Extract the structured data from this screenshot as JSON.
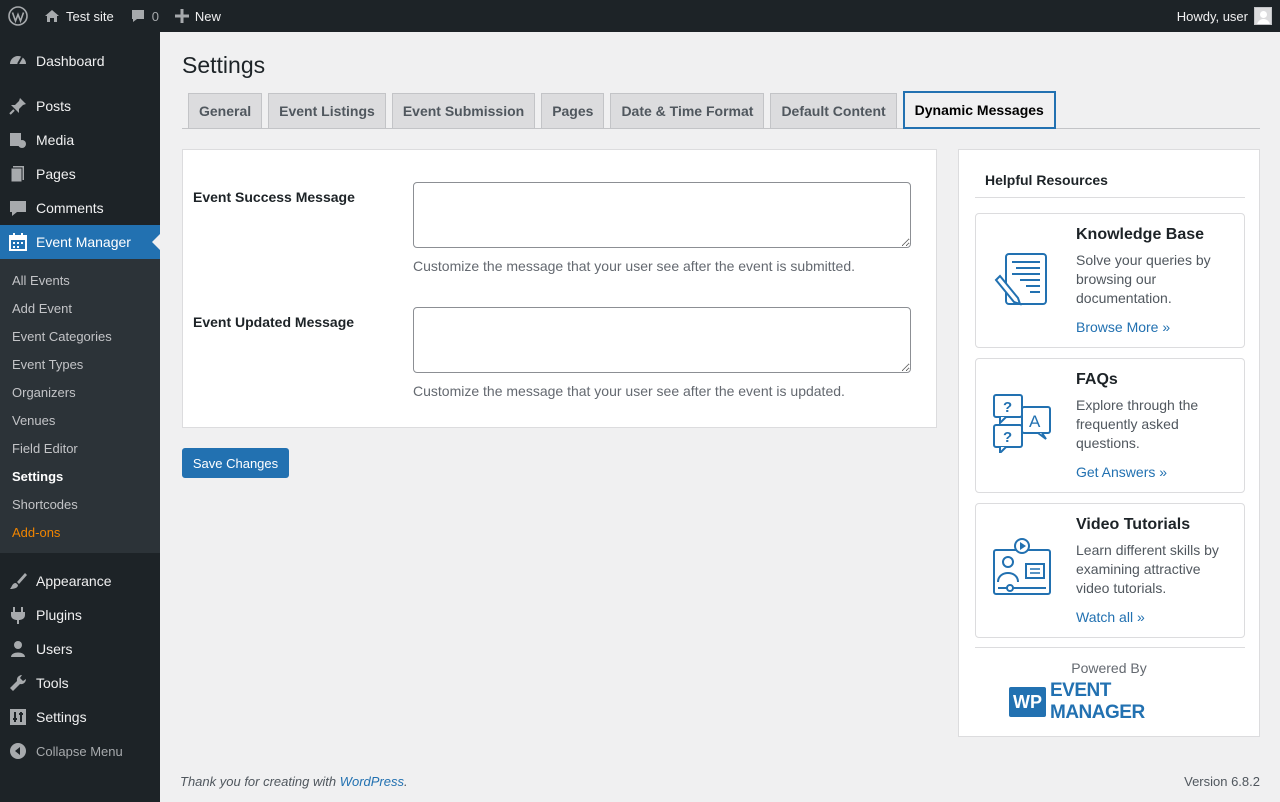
{
  "admin_bar": {
    "site_name": "Test site",
    "comments_count": "0",
    "new_label": "New",
    "howdy": "Howdy, user"
  },
  "sidebar": {
    "items_top": [
      {
        "label": "Dashboard",
        "icon": "dashboard-icon"
      },
      {
        "label": "Posts",
        "icon": "pin-icon"
      },
      {
        "label": "Media",
        "icon": "media-icon"
      },
      {
        "label": "Pages",
        "icon": "pages-icon"
      },
      {
        "label": "Comments",
        "icon": "comment-icon"
      },
      {
        "label": "Event Manager",
        "icon": "calendar-icon"
      }
    ],
    "submenu": [
      "All Events",
      "Add Event",
      "Event Categories",
      "Event Types",
      "Organizers",
      "Venues",
      "Field Editor",
      "Settings",
      "Shortcodes",
      "Add-ons"
    ],
    "items_bottom": [
      {
        "label": "Appearance",
        "icon": "brush-icon"
      },
      {
        "label": "Plugins",
        "icon": "plug-icon"
      },
      {
        "label": "Users",
        "icon": "user-icon"
      },
      {
        "label": "Tools",
        "icon": "wrench-icon"
      },
      {
        "label": "Settings",
        "icon": "settings-icon"
      }
    ],
    "collapse_label": "Collapse Menu"
  },
  "page": {
    "title": "Settings",
    "tabs": [
      "General",
      "Event Listings",
      "Event Submission",
      "Pages",
      "Date & Time Format",
      "Default Content",
      "Dynamic Messages"
    ],
    "active_tab": "Dynamic Messages"
  },
  "form": {
    "success_label": "Event Success Message",
    "success_value": "",
    "success_desc": "Customize the message that your user see after the event is submitted.",
    "updated_label": "Event Updated Message",
    "updated_value": "",
    "updated_desc": "Customize the message that your user see after the event is updated.",
    "save_label": "Save Changes"
  },
  "resources": {
    "title": "Helpful Resources",
    "cards": [
      {
        "title": "Knowledge Base",
        "desc": "Solve your queries by browsing our documentation.",
        "link": "Browse More »",
        "icon": "document-icon"
      },
      {
        "title": "FAQs",
        "desc": "Explore through the frequently asked questions.",
        "link": "Get Answers »",
        "icon": "faq-icon"
      },
      {
        "title": "Video Tutorials",
        "desc": "Learn different skills by examining attractive video tutorials.",
        "link": "Watch all »",
        "icon": "video-tutorial-icon"
      }
    ],
    "powered_by": "Powered By",
    "brand_wp": "WP",
    "brand_name": "EVENT MANAGER"
  },
  "footer": {
    "thanks_prefix": "Thank you for creating with",
    "wp_link": "WordPress",
    "thanks_suffix": ".",
    "version": "Version 6.8.2"
  },
  "colors": {
    "admin_dark": "#1d2327",
    "accent": "#2271b1",
    "addons": "#f18500"
  }
}
